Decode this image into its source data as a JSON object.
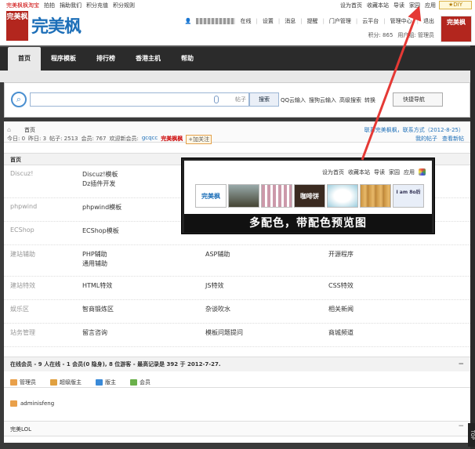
{
  "topbar": {
    "left": [
      "完美枫枫淘宝",
      "拍拍",
      "捐助我们",
      "积分充值",
      "积分规则"
    ],
    "right": [
      "设为首页",
      "收藏本站",
      "导读",
      "家园",
      "应用"
    ],
    "diy": "★DIY"
  },
  "header": {
    "logo_box": "完美枫",
    "logo_text": "完美枫",
    "user_links": [
      "在线",
      "设置",
      "消息",
      "提醒",
      "门户管理",
      "云平台",
      "管理中心",
      "退出"
    ],
    "points": [
      "积分: 865",
      "用户组: 管理员"
    ],
    "avatar": "完美枫"
  },
  "nav": {
    "items": [
      "首页",
      "程序模板",
      "排行榜",
      "香港主机",
      "帮助"
    ],
    "active_index": 0
  },
  "search": {
    "placeholder": "",
    "scope": "帖子",
    "button": "搜索",
    "hotlinks": [
      "QQ云输入",
      "搜狗云输入",
      "高级搜索",
      "转换"
    ],
    "quicknav": "快捷导航"
  },
  "crumb": {
    "home_icon": "home-icon",
    "title": "首页",
    "stats": [
      "今日: 0",
      "昨日: 3",
      "帖子: 2513",
      "会员: 767",
      "欢迎新会员:"
    ],
    "new_member": "gcqcc",
    "logo_label": "完美枫枫",
    "follow": "+加关注",
    "right_top": "联系完美枫枫，联系方式（2012-8-25）",
    "right_links": [
      "我的帖子",
      "查看新帖"
    ]
  },
  "section_title": "首页",
  "forums": [
    {
      "name": "Discuz!",
      "cols": [
        [
          "Discuz!模板",
          "Dz插件开发"
        ],
        [],
        []
      ]
    },
    {
      "name": "phpwind",
      "cols": [
        [
          "phpwind模板"
        ],
        [],
        []
      ]
    },
    {
      "name": "ECShop",
      "cols": [
        [
          "ECShop模板"
        ],
        [
          "ECShop插件"
        ],
        []
      ]
    },
    {
      "name": "建站辅助",
      "cols": [
        [
          "PHP辅助",
          "通用辅助"
        ],
        [
          "ASP辅助"
        ],
        [
          "开源程序"
        ]
      ]
    },
    {
      "name": "建站特效",
      "cols": [
        [
          "HTML特效"
        ],
        [
          "JS特效"
        ],
        [
          "CSS特效"
        ]
      ]
    },
    {
      "name": "娱乐区",
      "cols": [
        [
          "智商锻炼区"
        ],
        [
          "杂谈吹水"
        ],
        [
          "相关新闻"
        ]
      ]
    },
    {
      "name": "站务管理",
      "cols": [
        [
          "留言咨询"
        ],
        [
          "模板问题提问"
        ],
        [
          "商城频道"
        ]
      ]
    }
  ],
  "online": {
    "head": "在线会员 - 9 人在线 - 1 会员(0 隐身), 8 位游客 - 最高记录是 392 于 2012-7-27.",
    "roles": [
      "管理员",
      "超级版主",
      "版主",
      "会员"
    ],
    "role_colors": [
      "#e9a04a",
      "#e0a040",
      "#3a8ad8",
      "#6ab04a"
    ],
    "member": "adminisfeng"
  },
  "friendlink": "完美LOL",
  "overlay": {
    "links": [
      "设为首页",
      "收藏本站",
      "导读",
      "家园",
      "应用"
    ],
    "swatches": [
      "完美枫",
      "",
      "",
      "咖啡饼",
      "",
      "",
      "I am 8o后"
    ],
    "banner": "多配色，带配色预览图"
  },
  "toptab": "TOP"
}
